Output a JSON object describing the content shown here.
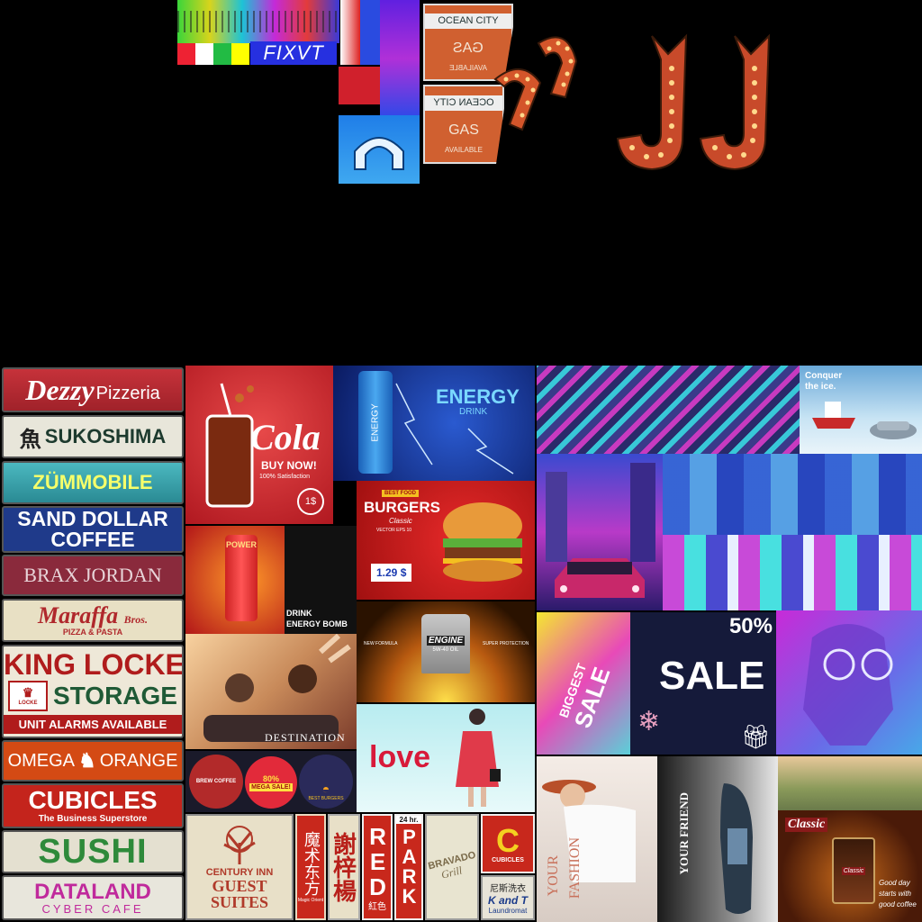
{
  "top": {
    "glitch_label": "FIXVT",
    "sign1": {
      "line1": "OCEAN CITY",
      "line2": "GAS",
      "line3": "AVAILABLE"
    },
    "sign2": {
      "line1": "OCEAN CITY",
      "line2": "GAS",
      "line3": "AVAILABLE"
    }
  },
  "signs": {
    "dezzy": {
      "main": "Dezzy",
      "sub": "Pizzeria"
    },
    "sukoshima": {
      "glyph": "魚",
      "text": "SUKOSHIMA"
    },
    "zummobile": "ZÜMMOBILE",
    "sand_dollar": {
      "line1": "SAND DOLLAR",
      "line2": "COFFEE"
    },
    "brax": "BRAX JORDAN",
    "maraffa": {
      "main": "Maraffa",
      "sub": "PIZZA & PASTA",
      "brothers": "Bros."
    },
    "king_locke": {
      "line1": "KING LOCKE",
      "line2": "STORAGE",
      "logo": "LOCKE",
      "line3": "UNIT ALARMS AVAILABLE"
    },
    "omega": {
      "left": "OMEGA",
      "right": "ORANGE"
    },
    "cubicles": {
      "main": "CUBICLES",
      "sub": "The Business Superstore"
    },
    "sushi": "SUSHI",
    "dataland": {
      "main": "DATALAND",
      "sub": "CYBER CAFE"
    }
  },
  "ads": {
    "cola": {
      "title": "Cola",
      "tag": "BUY NOW!",
      "tag2": "100% Satisfaction",
      "price": "1$"
    },
    "energy": {
      "title": "ENERGY",
      "sub": "DRINK",
      "can": "ENERGY"
    },
    "power": {
      "can": "POWER",
      "tag": "DRINK",
      "tag2": "ENERGY BOMB"
    },
    "burgers": {
      "badge": "BEST FOOD",
      "title": "BURGERS",
      "sub": "Classic",
      "vector": "VECTOR EPS 10",
      "price": "1.29 $"
    },
    "engine": {
      "label": "ENGINE",
      "label2": "5W-40 OIL",
      "left": "NEW FORMULA",
      "right": "SUPER PROTECTION"
    },
    "destination": {
      "title": "DESTINATION"
    },
    "badges": {
      "coffee": "BREW COFFEE",
      "sale_pct": "80%",
      "sale": "MEGA SALE!",
      "burger": "BEST BURGERS"
    },
    "love": {
      "title": "love"
    },
    "conquer": {
      "line1": "Conquer",
      "line2": "the ice."
    },
    "biggest": {
      "line1": "BIGGEST",
      "line2": "SALE"
    },
    "sale": {
      "pct": "50%",
      "title": "SALE"
    },
    "fashion": {
      "line1": "YOUR",
      "line2": "FASHION"
    },
    "friend": {
      "line1": "YOUR FRIEND"
    },
    "classic": {
      "brand": "Classic",
      "jar": "Classic",
      "tag1": "Good day",
      "tag2": "starts with",
      "tag3": "good coffee"
    }
  },
  "bottom_signs": {
    "century": {
      "line1": "CENTURY INN",
      "line2": "GUEST",
      "line3": "SUITES"
    },
    "magic": {
      "chars": "魔术东方",
      "sub": "Magic Orient"
    },
    "xie": {
      "chars": "謝梓楊"
    },
    "red": {
      "chars": "RED",
      "sub": "紅色"
    },
    "park": {
      "top": "24 hr.",
      "chars": "PARK"
    },
    "bravado": {
      "line1": "BRAVADO",
      "line2": "Grill"
    },
    "cubicles_c": {
      "label": "CUBICLES"
    },
    "kandt": {
      "chars": "尼斯洗衣",
      "line1": "K and T",
      "line2": "Laundromat"
    }
  }
}
